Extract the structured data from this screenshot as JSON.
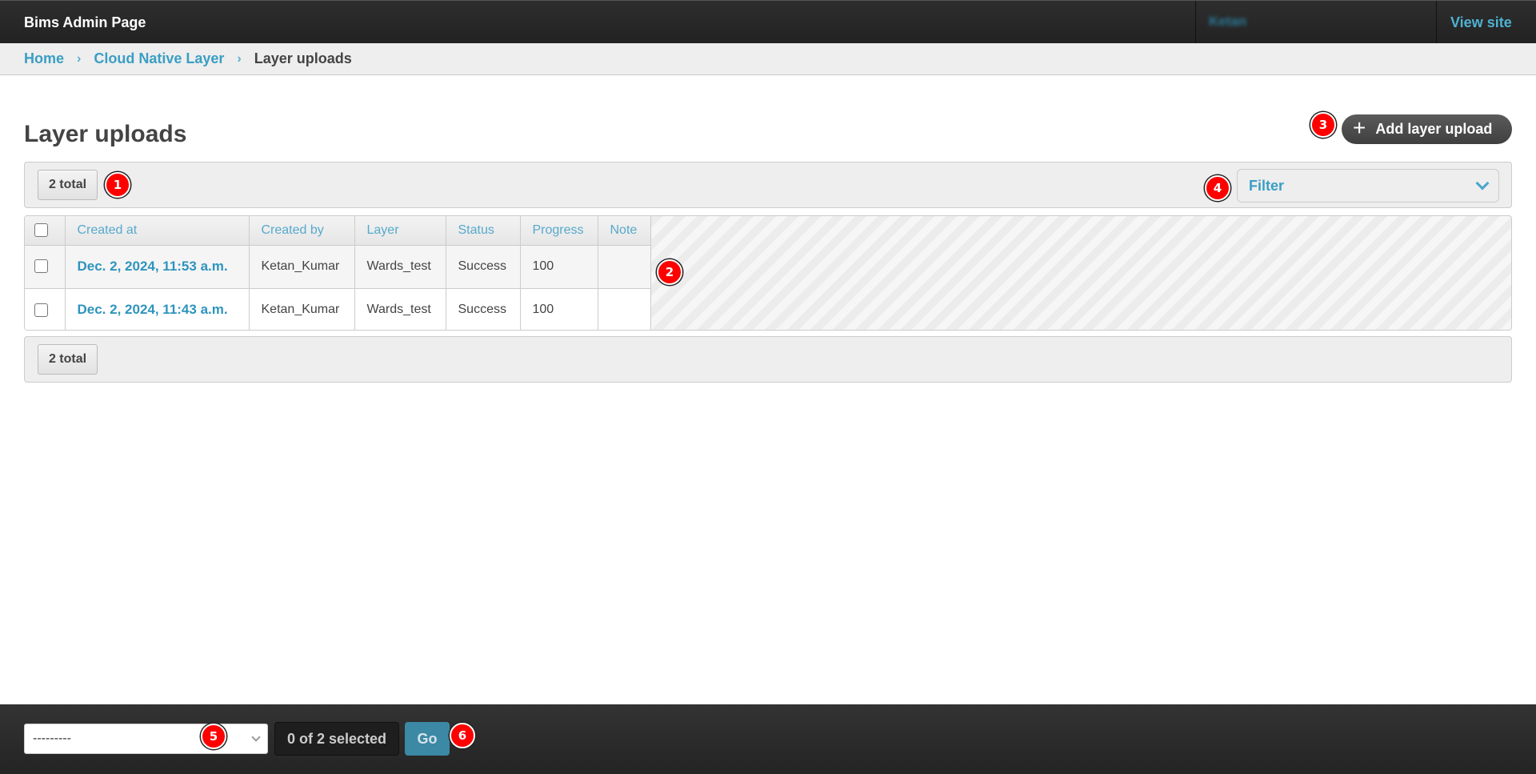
{
  "header": {
    "brand": "Bims Admin Page",
    "user_name": "Ketan",
    "view_site": "View site"
  },
  "breadcrumbs": {
    "home": "Home",
    "app": "Cloud Native Layer",
    "current": "Layer uploads",
    "separator": "›"
  },
  "page": {
    "title": "Layer uploads",
    "add_button": "Add layer upload",
    "add_icon": "+"
  },
  "toolbar": {
    "total_label": "2 total",
    "filter_label": "Filter"
  },
  "table": {
    "columns": [
      "Created at",
      "Created by",
      "Layer",
      "Status",
      "Progress",
      "Note"
    ],
    "rows": [
      {
        "created_at": "Dec. 2, 2024, 11:53 a.m.",
        "created_by": "Ketan_Kumar",
        "layer": "Wards_test",
        "status": "Success",
        "progress": "100",
        "note": ""
      },
      {
        "created_at": "Dec. 2, 2024, 11:43 a.m.",
        "created_by": "Ketan_Kumar",
        "layer": "Wards_test",
        "status": "Success",
        "progress": "100",
        "note": ""
      }
    ]
  },
  "pagination": {
    "total_label": "2 total"
  },
  "actions": {
    "select_value": "---------",
    "selected_counter": "0 of 2 selected",
    "go_label": "Go"
  },
  "annotations": [
    "1",
    "2",
    "3",
    "4",
    "5",
    "6"
  ],
  "colors": {
    "link": "#3a9ec4",
    "header_bg": "#2a2a2a",
    "badge": "#ff0000",
    "go_button": "#3b89a5"
  }
}
